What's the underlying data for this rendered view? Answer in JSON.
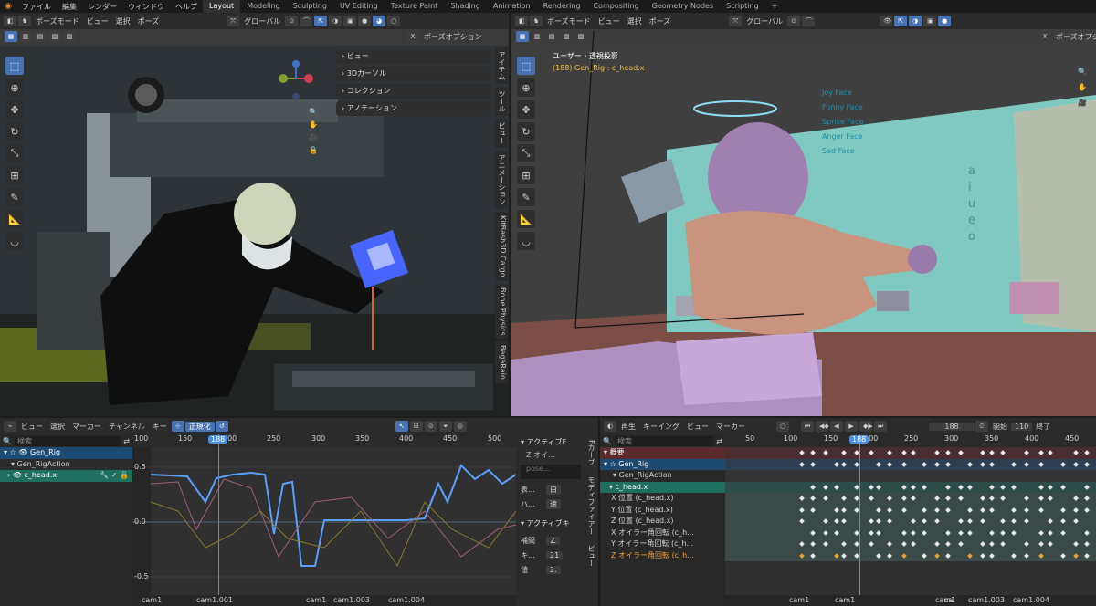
{
  "topbar": {
    "menus": [
      "ファイル",
      "編集",
      "レンダー",
      "ウィンドウ",
      "ヘルプ"
    ],
    "tabs": [
      "Layout",
      "Modeling",
      "Sculpting",
      "UV Editing",
      "Texture Paint",
      "Shading",
      "Animation",
      "Rendering",
      "Compositing",
      "Geometry Nodes",
      "Scripting"
    ],
    "add": "+"
  },
  "vp_left": {
    "mode": "ポーズモード",
    "menus": [
      "ビュー",
      "選択",
      "ポーズ"
    ],
    "orient": "グローバル",
    "pose_options": "ポーズオプション",
    "panels": [
      "ビュー",
      "3Dカーソル",
      "コレクション",
      "アノテーション"
    ],
    "side_tabs": [
      "アイテム",
      "ツール",
      "ビュー",
      "アニメーション",
      "KitBash3D Cargo",
      "Bone Physics",
      "BagaRain"
    ]
  },
  "vp_right": {
    "mode": "ポーズモード",
    "menus": [
      "ビュー",
      "選択",
      "ポーズ"
    ],
    "orient": "グローバル",
    "pose_options": "ポーズオプション",
    "view_name": "ユーザー・透視投影",
    "active": "(188) Gen_Rig : c_head.x",
    "shape_labels": [
      "Joy Face",
      "Funny Face",
      "Sprise Face",
      "Anger Face",
      "Sad Face",
      "a",
      "i",
      "u",
      "e",
      "o"
    ]
  },
  "graph": {
    "menus": [
      "ビュー",
      "選択",
      "マーカー",
      "チャンネル",
      "キー"
    ],
    "normalize": "正規化",
    "search": "検索",
    "channels": [
      "Gen_Rig",
      "Gen_RigAction",
      "c_head.x"
    ],
    "ruler": [
      "100",
      "150",
      "200",
      "250",
      "300",
      "350",
      "400",
      "450",
      "500"
    ],
    "current": "188",
    "yticks": [
      "0.5",
      "0.0",
      "-0.5"
    ],
    "markers": [
      "cam1",
      "cam1.001",
      "cam1",
      "cam1.003",
      "cam1.004"
    ],
    "side_tabs": [
      "Fカーブ",
      "モディファイアー",
      "ビュー"
    ],
    "prop": {
      "active_f": "アクティブF",
      "z_curve": "Z オイ...",
      "pose": "pose...",
      "color_label": "表...",
      "color_val": "白",
      "handle_label": "ハ...",
      "handle_val": "速",
      "active_k": "アクティブキ",
      "interp_label": "補間",
      "key_label": "キ...",
      "key_val": "21",
      "val_label": "値",
      "val_val": "2."
    }
  },
  "dopesheet": {
    "menus": [
      "再生",
      "キーイング",
      "ビュー",
      "マーカー"
    ],
    "frame": "188",
    "start_label": "開始",
    "start_val": "110",
    "end_label": "終了",
    "search": "検索",
    "ruler": [
      "50",
      "100",
      "150",
      "200",
      "250",
      "300",
      "350",
      "400",
      "450"
    ],
    "current": "188",
    "rows": [
      "概要",
      "Gen_Rig",
      "Gen_RigAction",
      "c_head.x",
      "X 位置 (c_head.x)",
      "Y 位置 (c_head.x)",
      "Z 位置 (c_head.x)",
      "X オイラー角回転 (c_h...",
      "Y オイラー角回転 (c_h...",
      "Z オイラー角回転 (c_h..."
    ],
    "markers": [
      "cam1",
      "cam1",
      "cam1",
      "ca",
      "cam1.003",
      "cam1.004"
    ]
  },
  "colors": {
    "accent": "#4772b3",
    "playhead": "#4b8fe0",
    "fcurve": "#5aa0ff",
    "select": "#1f6f5f"
  }
}
